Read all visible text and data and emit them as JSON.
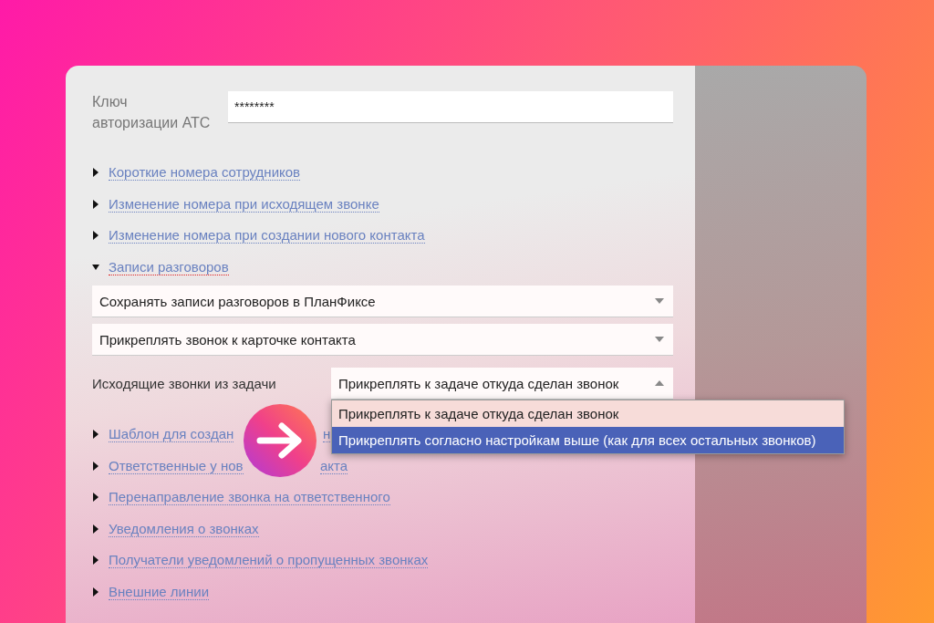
{
  "auth_key": {
    "label": "Ключ авторизации АТС",
    "value": "********"
  },
  "sections_top": [
    {
      "label": "Короткие номера сотрудников",
      "expanded": false
    },
    {
      "label": "Изменение номера при исходящем звонке",
      "expanded": false
    },
    {
      "label": "Изменение номера при создании нового контакта",
      "expanded": false
    },
    {
      "label": "Записи разговоров",
      "expanded": true
    }
  ],
  "selects": [
    {
      "value": "Сохранять записи разговоров в ПланФиксе"
    },
    {
      "value": "Прикреплять звонок к карточке контакта"
    }
  ],
  "outgoing": {
    "label": "Исходящие звонки из задачи",
    "value": "Прикреплять к задаче откуда сделан звонок",
    "expanded": true,
    "options": [
      {
        "label": "Прикреплять к задаче откуда сделан звонок",
        "highlighted": false
      },
      {
        "label": "Прикреплять согласно настройкам выше (как для всех остальных звонков)",
        "highlighted": true
      }
    ]
  },
  "sections_bottom": [
    {
      "label": "Шаблон для создан",
      "tail": "н",
      "expanded": false
    },
    {
      "label": "Ответственные у нов",
      "tail": "акта",
      "expanded": false
    },
    {
      "label": "Перенаправление звонка на ответственного",
      "expanded": false
    },
    {
      "label": "Уведомления о звонках",
      "expanded": false
    },
    {
      "label": "Получатели уведомлений о пропущенных звонках",
      "expanded": false
    },
    {
      "label": "Внешние линии",
      "expanded": false
    }
  ]
}
